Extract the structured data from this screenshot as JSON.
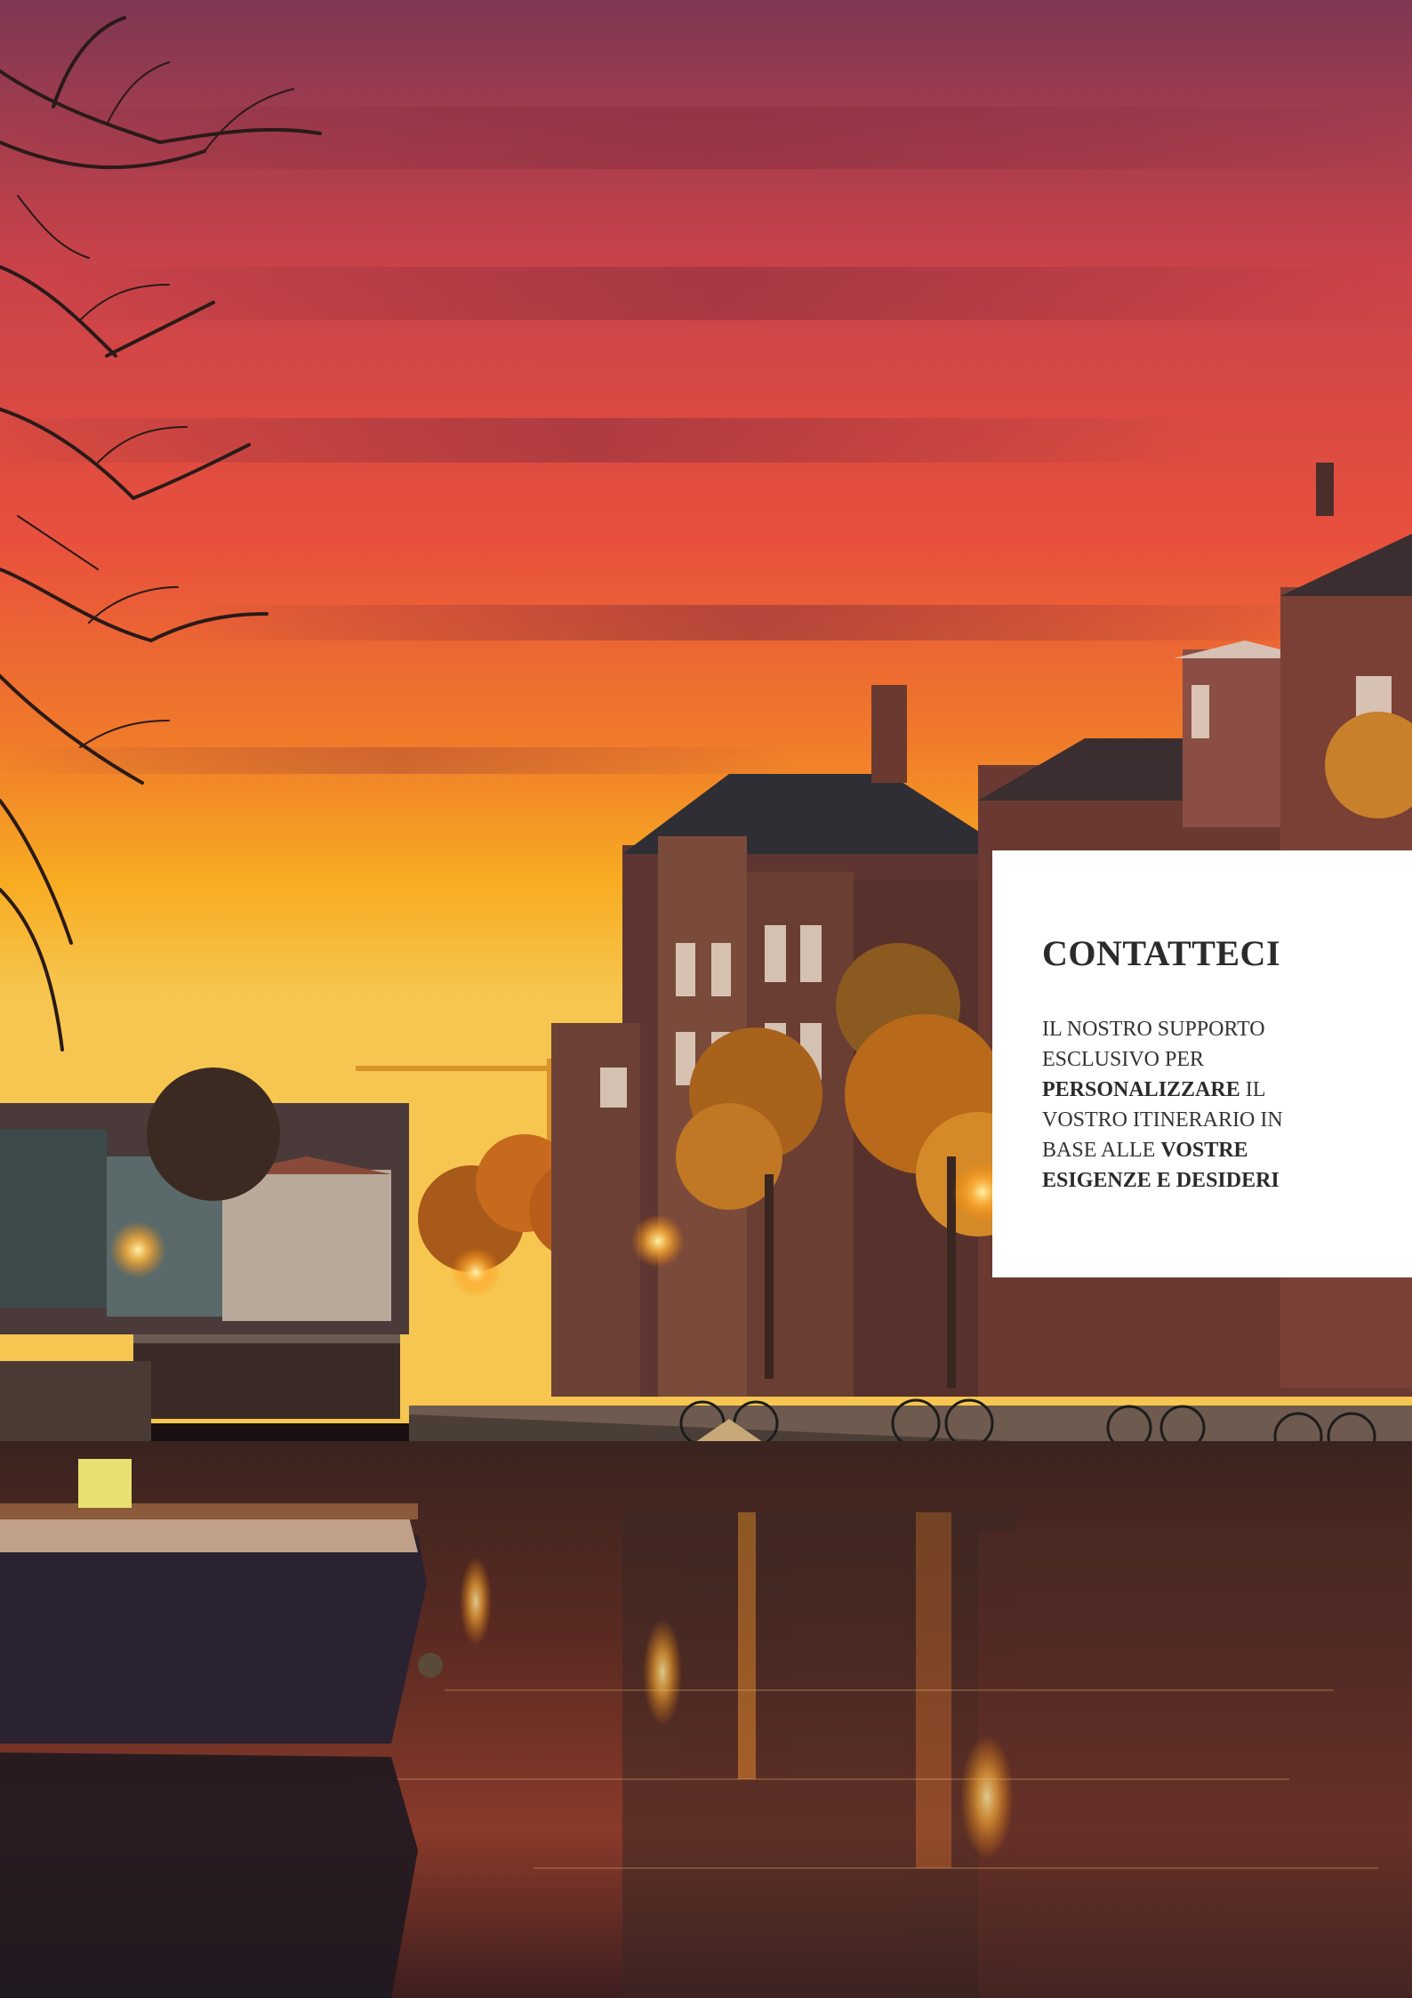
{
  "photo": {
    "subject": "canal-at-sunset-photo",
    "colors": {
      "sky_top": "#8a3a55",
      "sky_mid": "#e0503e",
      "sky_low": "#f7a21f",
      "water": "#2a1a1a",
      "brick": "#6e3a30"
    }
  },
  "contact": {
    "title": "CONTATTECI",
    "body": {
      "part1": "IL NOSTRO SUPPORTO ESCLUSIVO PER ",
      "bold1": "PERSONALIZZARE",
      "part2": " IL VOSTRO ITINERARIO IN BASE ALLE ",
      "bold2": "VOSTRE ESIGENZE E DESIDERI"
    },
    "colors": {
      "card_bg": "#ffffff",
      "text": "#2b2b2b"
    }
  }
}
